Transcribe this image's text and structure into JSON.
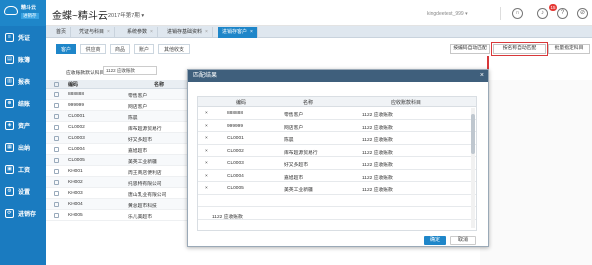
{
  "app": {
    "logo_name": "精斗云",
    "logo_tag": "进销存",
    "title": "金蝶~精斗云",
    "period": "2017年第7期 ▾",
    "user": "kingdeetest_999 ▾",
    "badge_count": "15",
    "help_icon": "?",
    "user_icon": "⊘"
  },
  "sidebar": {
    "items": [
      {
        "icon": "≡",
        "label": "凭证"
      },
      {
        "icon": "▤",
        "label": "账簿"
      },
      {
        "icon": "▥",
        "label": "报表"
      },
      {
        "icon": "⊕",
        "label": "结账"
      },
      {
        "icon": "◈",
        "label": "资产"
      },
      {
        "icon": "▦",
        "label": "出纳"
      },
      {
        "icon": "▣",
        "label": "工资"
      },
      {
        "icon": "⚙",
        "label": "设置"
      },
      {
        "icon": "⟳",
        "label": "进销存"
      }
    ]
  },
  "tabs": [
    {
      "label": "首页"
    },
    {
      "label": "凭证与科目"
    },
    {
      "label": "系统参数"
    },
    {
      "label": "进销存基础资料"
    },
    {
      "label": "进销存客户"
    }
  ],
  "subtabs": [
    "客户",
    "供应商",
    "商品",
    "账户",
    "其他收支"
  ],
  "actions": {
    "a1": "按编码自动匹配",
    "a2": "按名称自动匹配",
    "a3": "批量指定科目"
  },
  "filter": {
    "label": "应收账款默认科目",
    "value": "1122 应收账款"
  },
  "bg_table": {
    "col_code": "编码",
    "col_name": "名称",
    "rows": [
      {
        "code": "888888",
        "name": "零售客户",
        "extra": ""
      },
      {
        "code": "999999",
        "name": "网店客户",
        "extra": ""
      },
      {
        "code": "CL0001",
        "name": "陈晨",
        "extra": ""
      },
      {
        "code": "CL0002",
        "name": "库布超源贸易行",
        "extra": ""
      },
      {
        "code": "CL0003",
        "name": "好又多超市",
        "extra": ""
      },
      {
        "code": "CL0004",
        "name": "嘉旭超市",
        "extra": ""
      },
      {
        "code": "CL0005",
        "name": "美英工业新疆",
        "extra": ""
      },
      {
        "code": "KH001",
        "name": "周王商店便利店",
        "extra": ""
      },
      {
        "code": "KH002",
        "name": "托思特有限公司",
        "extra": ""
      },
      {
        "code": "KH003",
        "name": "唐山乳业有限公司",
        "extra": ""
      },
      {
        "code": "KH004",
        "name": "黄总超市科技",
        "extra": ""
      },
      {
        "code": "KH005",
        "name": "乐儿美超市",
        "extra": "1122 应收账款"
      }
    ]
  },
  "dialog": {
    "title": "匹配结果",
    "close": "×",
    "col_code": "编码",
    "col_name": "名称",
    "col_account": "应收账款科目",
    "rows": [
      {
        "code": "888888",
        "name": "零售客户",
        "account": "1122 应收账款"
      },
      {
        "code": "999999",
        "name": "网店客户",
        "account": "1122 应收账款"
      },
      {
        "code": "CL0001",
        "name": "陈晨",
        "account": "1122 应收账款"
      },
      {
        "code": "CL0002",
        "name": "库布超源贸易行",
        "account": "1122 应收账款"
      },
      {
        "code": "CL0003",
        "name": "好又多超市",
        "account": "1122 应收账款"
      },
      {
        "code": "CL0004",
        "name": "嘉旭超市",
        "account": "1122 应收账款"
      },
      {
        "code": "CL0005",
        "name": "美英工业新疆",
        "account": "1122 应收账款"
      },
      {
        "code": "",
        "name": "",
        "account": ""
      },
      {
        "code": "",
        "name": "",
        "account": ""
      },
      {
        "code": "",
        "name": "",
        "account": ""
      }
    ],
    "ok": "确定",
    "cancel": "取消"
  },
  "colors": {
    "brand": "#1e86c9",
    "sidebar": "#1a7bc0",
    "dialog_header": "#3f5f7c",
    "highlight": "#d8383a"
  }
}
